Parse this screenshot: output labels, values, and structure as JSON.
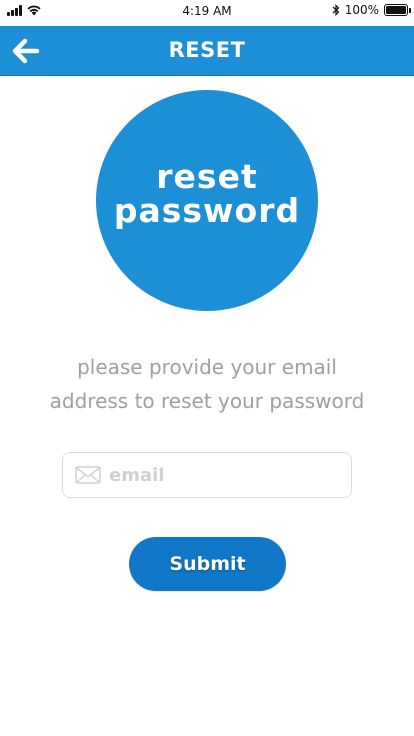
{
  "status_bar": {
    "time": "4:19 AM",
    "battery_label": "100%",
    "battery_level": 1.0
  },
  "header": {
    "title": "RESET",
    "back_icon": "arrow-left-icon"
  },
  "hero": {
    "line1": "reset",
    "line2": "password"
  },
  "instructions": {
    "line1": "please provide your email",
    "line2": "address to reset your password"
  },
  "email_field": {
    "placeholder": "email",
    "value": "",
    "icon": "mail-icon"
  },
  "submit": {
    "label": "Submit"
  },
  "colors": {
    "primary": "#1d8fd6",
    "button": "#1177c8",
    "muted_text": "#a0a0a0"
  }
}
